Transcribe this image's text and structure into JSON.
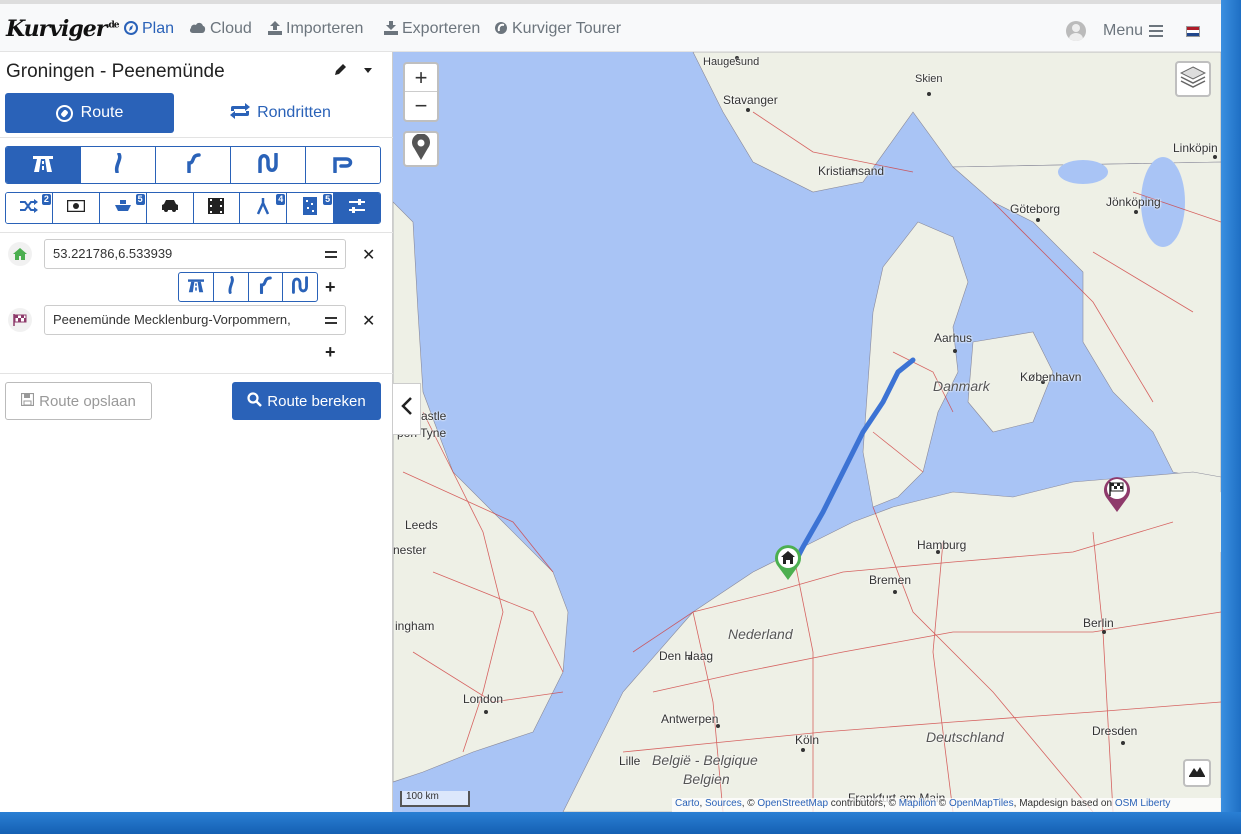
{
  "nav": {
    "logo": "Kurviger",
    "logo_suffix": ".de",
    "items": [
      {
        "label": "Plan",
        "icon": "compass-icon"
      },
      {
        "label": "Cloud",
        "icon": "cloud-icon"
      },
      {
        "label": "Importeren",
        "icon": "upload-icon"
      },
      {
        "label": "Exporteren",
        "icon": "download-icon"
      },
      {
        "label": "Kurviger Tourer",
        "icon": "tourer-icon"
      }
    ],
    "menu_label": "Menu"
  },
  "sidebar": {
    "route_title": "Groningen - Peenemünde",
    "tab_route": "Route",
    "tab_rondritten": "Rondritten",
    "avoid_badges": [
      "2",
      "5",
      "4",
      "5"
    ],
    "waypoints": [
      {
        "value": "53.221786,6.533939",
        "icon": "home-icon"
      },
      {
        "value": "Peenemünde Mecklenburg-Vorpommern,",
        "icon": "finish-flag-icon"
      }
    ],
    "save_label": "Route opslaan",
    "calc_label": "Route bereken"
  },
  "map": {
    "labels": {
      "haugesund": "Haugesund",
      "skien": "Skien",
      "stavanger": "Stavanger",
      "kristiansand": "Kristiansand",
      "goteborg": "Göteborg",
      "jonkoping": "Jönköping",
      "linkoping": "Linköpin",
      "aarhus": "Aarhus",
      "danmark": "Danmark",
      "kobenhavn": "København",
      "castle": "astle",
      "upontyne": "pon Tyne",
      "leeds": "Leeds",
      "chester": "nester",
      "hamburg": "Hamburg",
      "bremen": "Bremen",
      "nederland": "Nederland",
      "nottingham": "ingham",
      "berlin": "Berlin",
      "denhaag": "Den Haag",
      "london": "London",
      "antwerpen": "Antwerpen",
      "koln": "Köln",
      "deutschland": "Deutschland",
      "dresden": "Dresden",
      "lille": "Lille",
      "belgie": "België - Belgique",
      "belgien": "Belgien",
      "frankfurt": "Frankfurt am Main"
    },
    "scale_label": "100 km",
    "attribution": {
      "carto": "Carto",
      "sources": "Sources",
      "osm": "OpenStreetMap",
      "contributors": "contributors,",
      "mapilion": "Mapilion",
      "omt": "OpenMapTiles",
      "mapdesign": "Mapdesign based on",
      "liberty": "OSM Liberty"
    }
  },
  "colors": {
    "accent": "#2a62b8",
    "sea": "#a9c4f5",
    "land": "#eef0e6",
    "route": "#3c73d4",
    "start_marker": "#4caf50",
    "end_marker": "#8e3a6b"
  }
}
